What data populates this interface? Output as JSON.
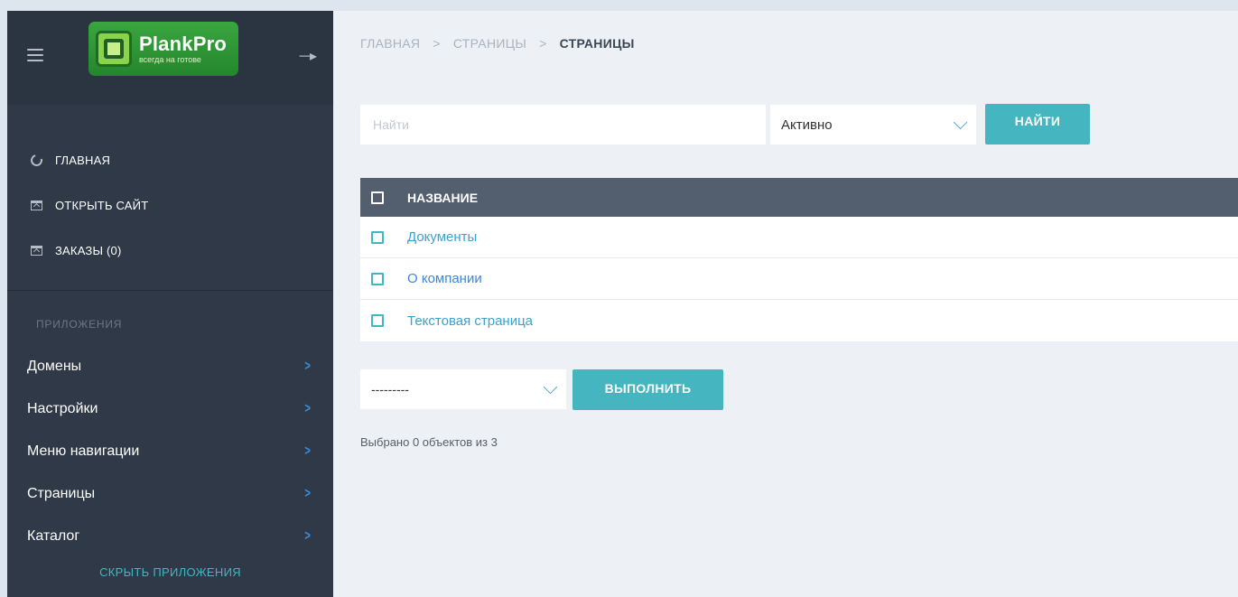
{
  "sidebar": {
    "logo": {
      "title": "PlankPro",
      "subtitle": "всегда на готове"
    },
    "top_links": [
      {
        "label": "ГЛАВНАЯ",
        "icon": "loader-icon"
      },
      {
        "label": "ОТКРЫТЬ САЙТ",
        "icon": "open-site-icon"
      },
      {
        "label": "ЗАКАЗЫ (0)",
        "icon": "orders-icon"
      }
    ],
    "section_title": "ПРИЛОЖЕНИЯ",
    "apps": [
      {
        "label": "Домены"
      },
      {
        "label": "Настройки"
      },
      {
        "label": "Меню навигации"
      },
      {
        "label": "Страницы"
      },
      {
        "label": "Каталог"
      }
    ],
    "hide_label": "СКРЫТЬ ПРИЛОЖЕНИЯ"
  },
  "breadcrumb": {
    "items": [
      "ГЛАВНАЯ",
      "СТРАНИЦЫ"
    ],
    "separator": ">",
    "current": "СТРАНИЦЫ"
  },
  "search": {
    "placeholder": "Найти",
    "value": "",
    "status_selected": "Активно",
    "button_label": "НАЙТИ"
  },
  "table": {
    "header": "НАЗВАНИЕ",
    "rows": [
      {
        "name": "Документы"
      },
      {
        "name": "О компании"
      },
      {
        "name": "Текстовая страница"
      }
    ]
  },
  "actions": {
    "selected": "---------",
    "button_label": "ВЫПОЛНИТЬ",
    "selected_info": "Выбрано 0 объектов из 3"
  },
  "colors": {
    "sidebar_bg": "#2f3947",
    "accent": "#45b5c0",
    "table_header_bg": "#535f6e",
    "link": "#3aa2cf"
  }
}
